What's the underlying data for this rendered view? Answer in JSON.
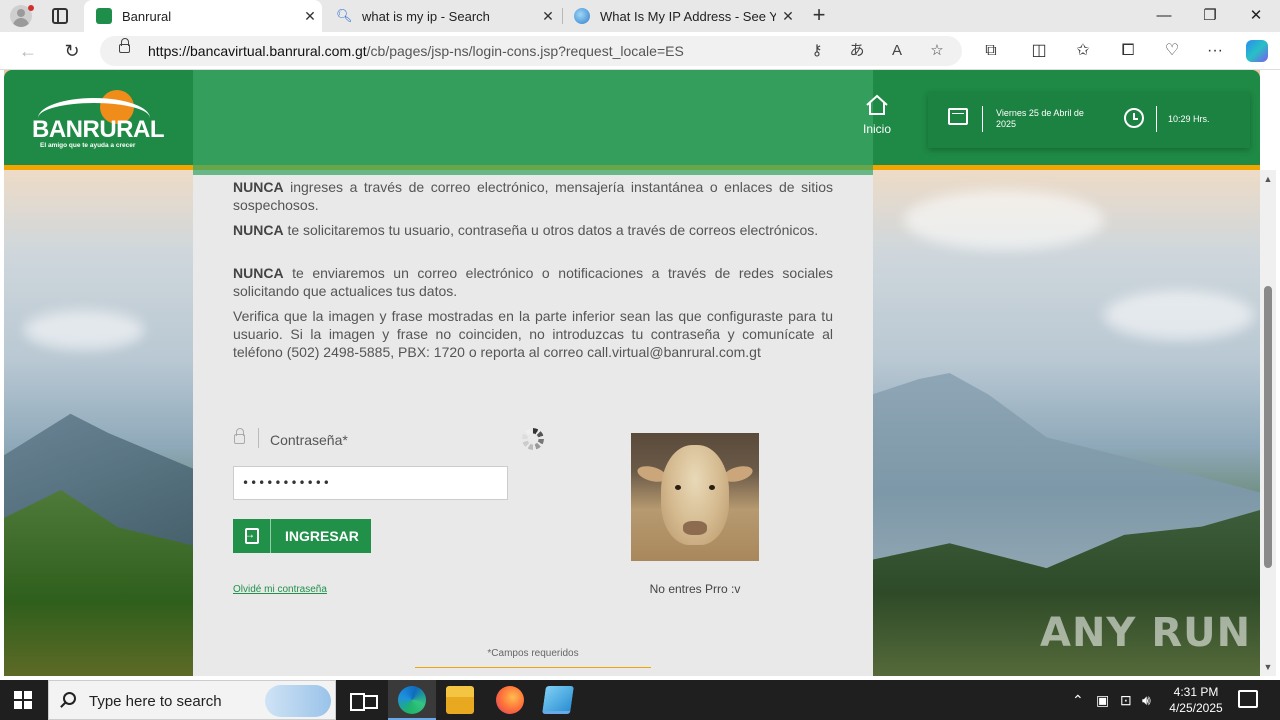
{
  "browser": {
    "tabs": [
      {
        "title": "Banrural",
        "active": true,
        "icon": "banrural-favicon"
      },
      {
        "title": "what is my ip - Search",
        "active": false,
        "icon": "search-icon"
      },
      {
        "title": "What Is My IP Address - See Your",
        "active": false,
        "icon": "globe-icon"
      }
    ],
    "url_host": "https://bancavirtual.banrural.com.gt",
    "url_path": "/cb/pages/jsp-ns/login-cons.jsp?request_locale=ES",
    "colors": {
      "accent": "#1e8a45",
      "stripe": "#f0a500"
    }
  },
  "header": {
    "logo_text": "BANRURAL",
    "logo_tagline": "El amigo que te ayuda a crecer",
    "home_label": "Inicio",
    "date": "Viernes 25 de Abril de 2025",
    "time": "10:29 Hrs."
  },
  "content": {
    "warning1_bold": "NUNCA",
    "warning1_text": " ingreses a través de correo electrónico, mensajería instantánea o enlaces de sitios sospechosos.",
    "warning2_bold": "NUNCA",
    "warning2_text": " te solicitaremos tu usuario, contraseña u otros datos a través de correos electrónicos.",
    "warning3_bold": "NUNCA",
    "warning3_text": " te enviaremos un correo electrónico o notificaciones a través de redes sociales solicitando que actualices tus datos.",
    "verify_text": "Verifica que la imagen y frase mostradas en la parte inferior sean las que configuraste para tu usuario. Si la imagen y frase no coinciden, no introduzcas tu contraseña y comunícate al teléfono (502) 2498-5885, PBX: 1720 o reporta al correo call.virtual@banrural.com.gt",
    "password_label": "Contraseña*",
    "password_value": "•••••••••••",
    "submit_label": "INGRESAR",
    "forgot_label": "Olvidé mi contraseña",
    "security_phrase": "No entres Prro :v",
    "required_note": "*Campos requeridos"
  },
  "watermark": "ANY RUN",
  "taskbar": {
    "search_placeholder": "Type here to search",
    "time": "4:31 PM",
    "date": "4/25/2025"
  }
}
